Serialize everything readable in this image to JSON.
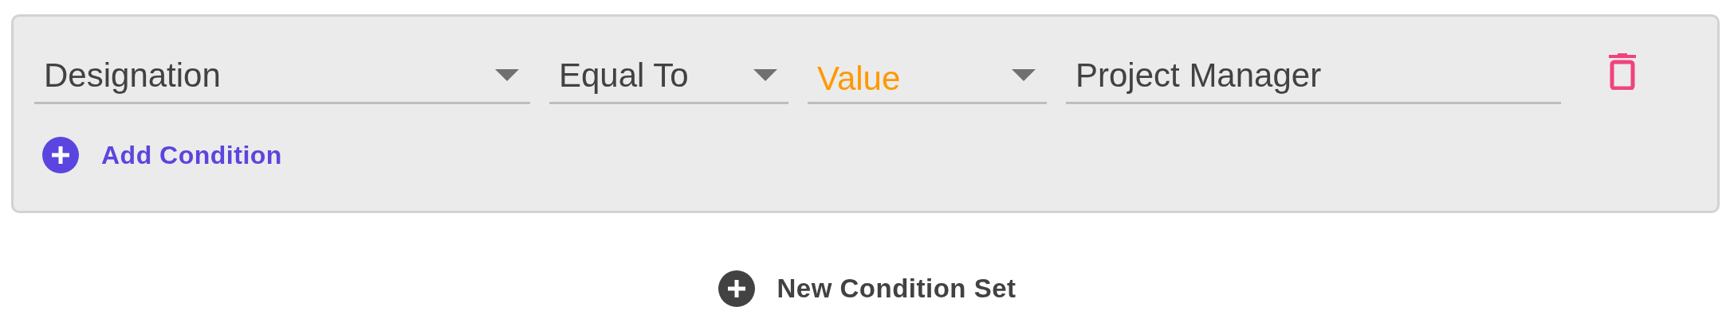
{
  "condition_sets": [
    {
      "conditions": [
        {
          "fields": [
            {
              "kind": "select",
              "value": "Designation"
            },
            {
              "kind": "select",
              "value": "Equal To"
            },
            {
              "kind": "select",
              "placeholder": "Value"
            },
            {
              "kind": "input",
              "value": "Project Manager"
            }
          ]
        }
      ],
      "add_condition": "Add Condition"
    }
  ],
  "new_condition_set": "New Condition Set"
}
